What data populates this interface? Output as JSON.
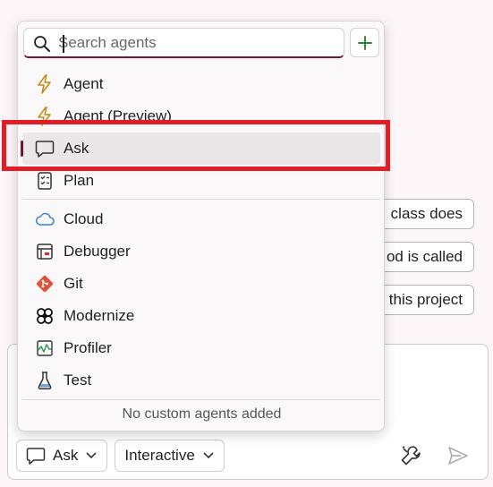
{
  "suggestions": [
    {
      "text": "class does"
    },
    {
      "text": "od is called"
    },
    {
      "text": "this project"
    }
  ],
  "search": {
    "placeholder": "Search agents",
    "value": ""
  },
  "agents_builtin": [
    {
      "label": "Agent",
      "icon": "lightning-icon"
    },
    {
      "label": "Agent (Preview)",
      "icon": "lightning-icon"
    },
    {
      "label": "Ask",
      "icon": "chat-bubble-icon",
      "selected": true
    },
    {
      "label": "Plan",
      "icon": "checklist-icon"
    }
  ],
  "agents_tools": [
    {
      "label": "Cloud",
      "icon": "cloud-icon"
    },
    {
      "label": "Debugger",
      "icon": "window-icon"
    },
    {
      "label": "Git",
      "icon": "git-icon"
    },
    {
      "label": "Modernize",
      "icon": "modernize-icon"
    },
    {
      "label": "Profiler",
      "icon": "profiler-icon"
    },
    {
      "label": "Test",
      "icon": "beaker-icon"
    }
  ],
  "footer": {
    "empty_text": "No custom agents added"
  },
  "bottom_bar": {
    "mode_label": "Ask",
    "interaction_label": "Interactive"
  },
  "colors": {
    "accent": "#7a1335",
    "add": "#2e8b2e",
    "highlight": "#e21d24",
    "git": "#e0513a",
    "cloud": "#3b82c4"
  }
}
